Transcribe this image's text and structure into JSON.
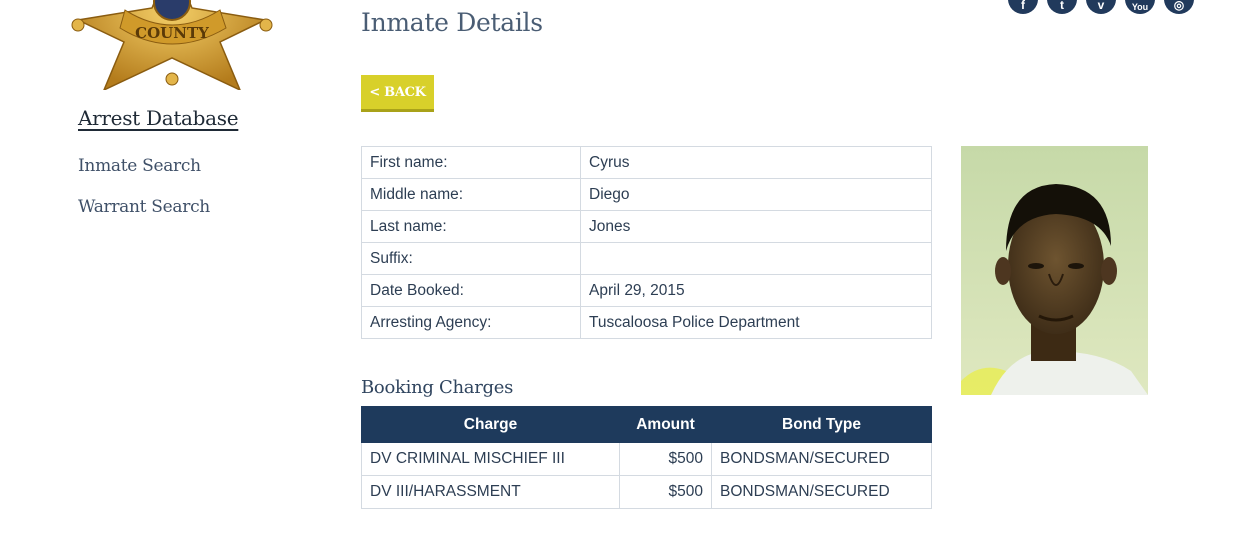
{
  "sidebar": {
    "title": "Arrest Database",
    "links": [
      "Inmate Search",
      "Warrant Search"
    ]
  },
  "logo": {
    "text": "COUNTY",
    "colors": {
      "gold": "#d6a22a",
      "gold_dark": "#a8741a",
      "ribbon": "#c8921f"
    }
  },
  "page": {
    "title": "Inmate Details",
    "back_label": "< BACK"
  },
  "social": {
    "icons": [
      "facebook-icon",
      "twitter-icon",
      "vimeo-icon",
      "youtube-icon",
      "instagram-icon"
    ],
    "glyphs": [
      "f",
      "t",
      "v",
      "You",
      "◎"
    ]
  },
  "details": {
    "rows": [
      {
        "label": "First name:",
        "value": "Cyrus"
      },
      {
        "label": "Middle name:",
        "value": "Diego"
      },
      {
        "label": "Last name:",
        "value": "Jones"
      },
      {
        "label": "Suffix:",
        "value": ""
      },
      {
        "label": "Date Booked:",
        "value": "April 29, 2015"
      },
      {
        "label": "Arresting Agency:",
        "value": "Tuscaloosa Police Department"
      }
    ]
  },
  "charges": {
    "title": "Booking Charges",
    "headers": [
      "Charge",
      "Amount",
      "Bond Type"
    ],
    "rows": [
      {
        "charge": "DV CRIMINAL MISCHIEF III",
        "amount": "$500",
        "bond_type": "BONDSMAN/SECURED"
      },
      {
        "charge": "DV III/HARASSMENT",
        "amount": "$500",
        "bond_type": "BONDSMAN/SECURED"
      }
    ]
  },
  "colors": {
    "accent_navy": "#1e3a5c",
    "back_button": "#d8d02a",
    "text": "#2d3e53"
  }
}
